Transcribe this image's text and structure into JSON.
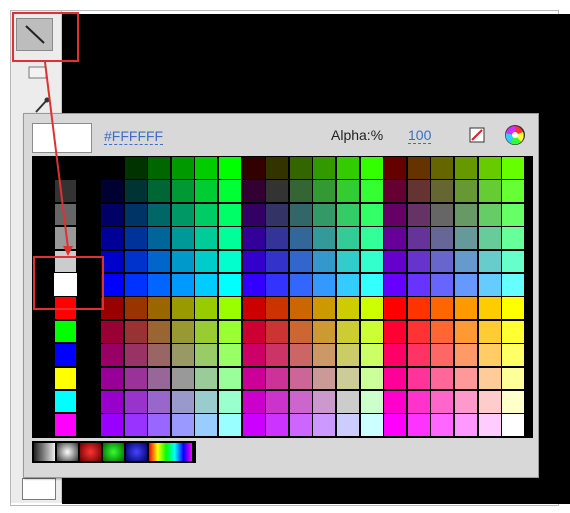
{
  "tools": {
    "line": "line-tool-icon",
    "rect": "rectangle-tool-icon",
    "dropper": "eyedropper-icon",
    "fill_bottom": "fill-color-swatch"
  },
  "color_popup": {
    "hex_value": "#FFFFFF",
    "alpha_label": "Alpha:%",
    "alpha_value": "100",
    "icons": {
      "no_color": "no-color-icon",
      "wheel": "color-wheel-icon"
    },
    "selected_swatch": "#FFFFFF",
    "left_column": [
      "#000000",
      "#333333",
      "#666666",
      "#999999",
      "#CCCCCC",
      "#FFFFFF",
      "#FF0000",
      "#00FF00",
      "#0000FF",
      "#FFFF00",
      "#00FFFF",
      "#FF00FF"
    ],
    "gradients": [
      {
        "name": "gray-linear",
        "css": "linear-gradient(90deg,#222,#eee)"
      },
      {
        "name": "gray-radial",
        "css": "radial-gradient(circle,#fff,#333)"
      },
      {
        "name": "red-radial",
        "css": "radial-gradient(circle,#f33,#600)"
      },
      {
        "name": "green-radial",
        "css": "radial-gradient(circle,#3f3,#060)"
      },
      {
        "name": "blue-radial",
        "css": "radial-gradient(circle,#44f,#006)"
      },
      {
        "name": "rainbow-linear",
        "css": "linear-gradient(90deg,#f00,#ff0,#0f0,#0ff,#00f,#f0f)"
      }
    ]
  },
  "colors": {
    "annotation": "#e03030",
    "link": "#3a6fc4"
  }
}
